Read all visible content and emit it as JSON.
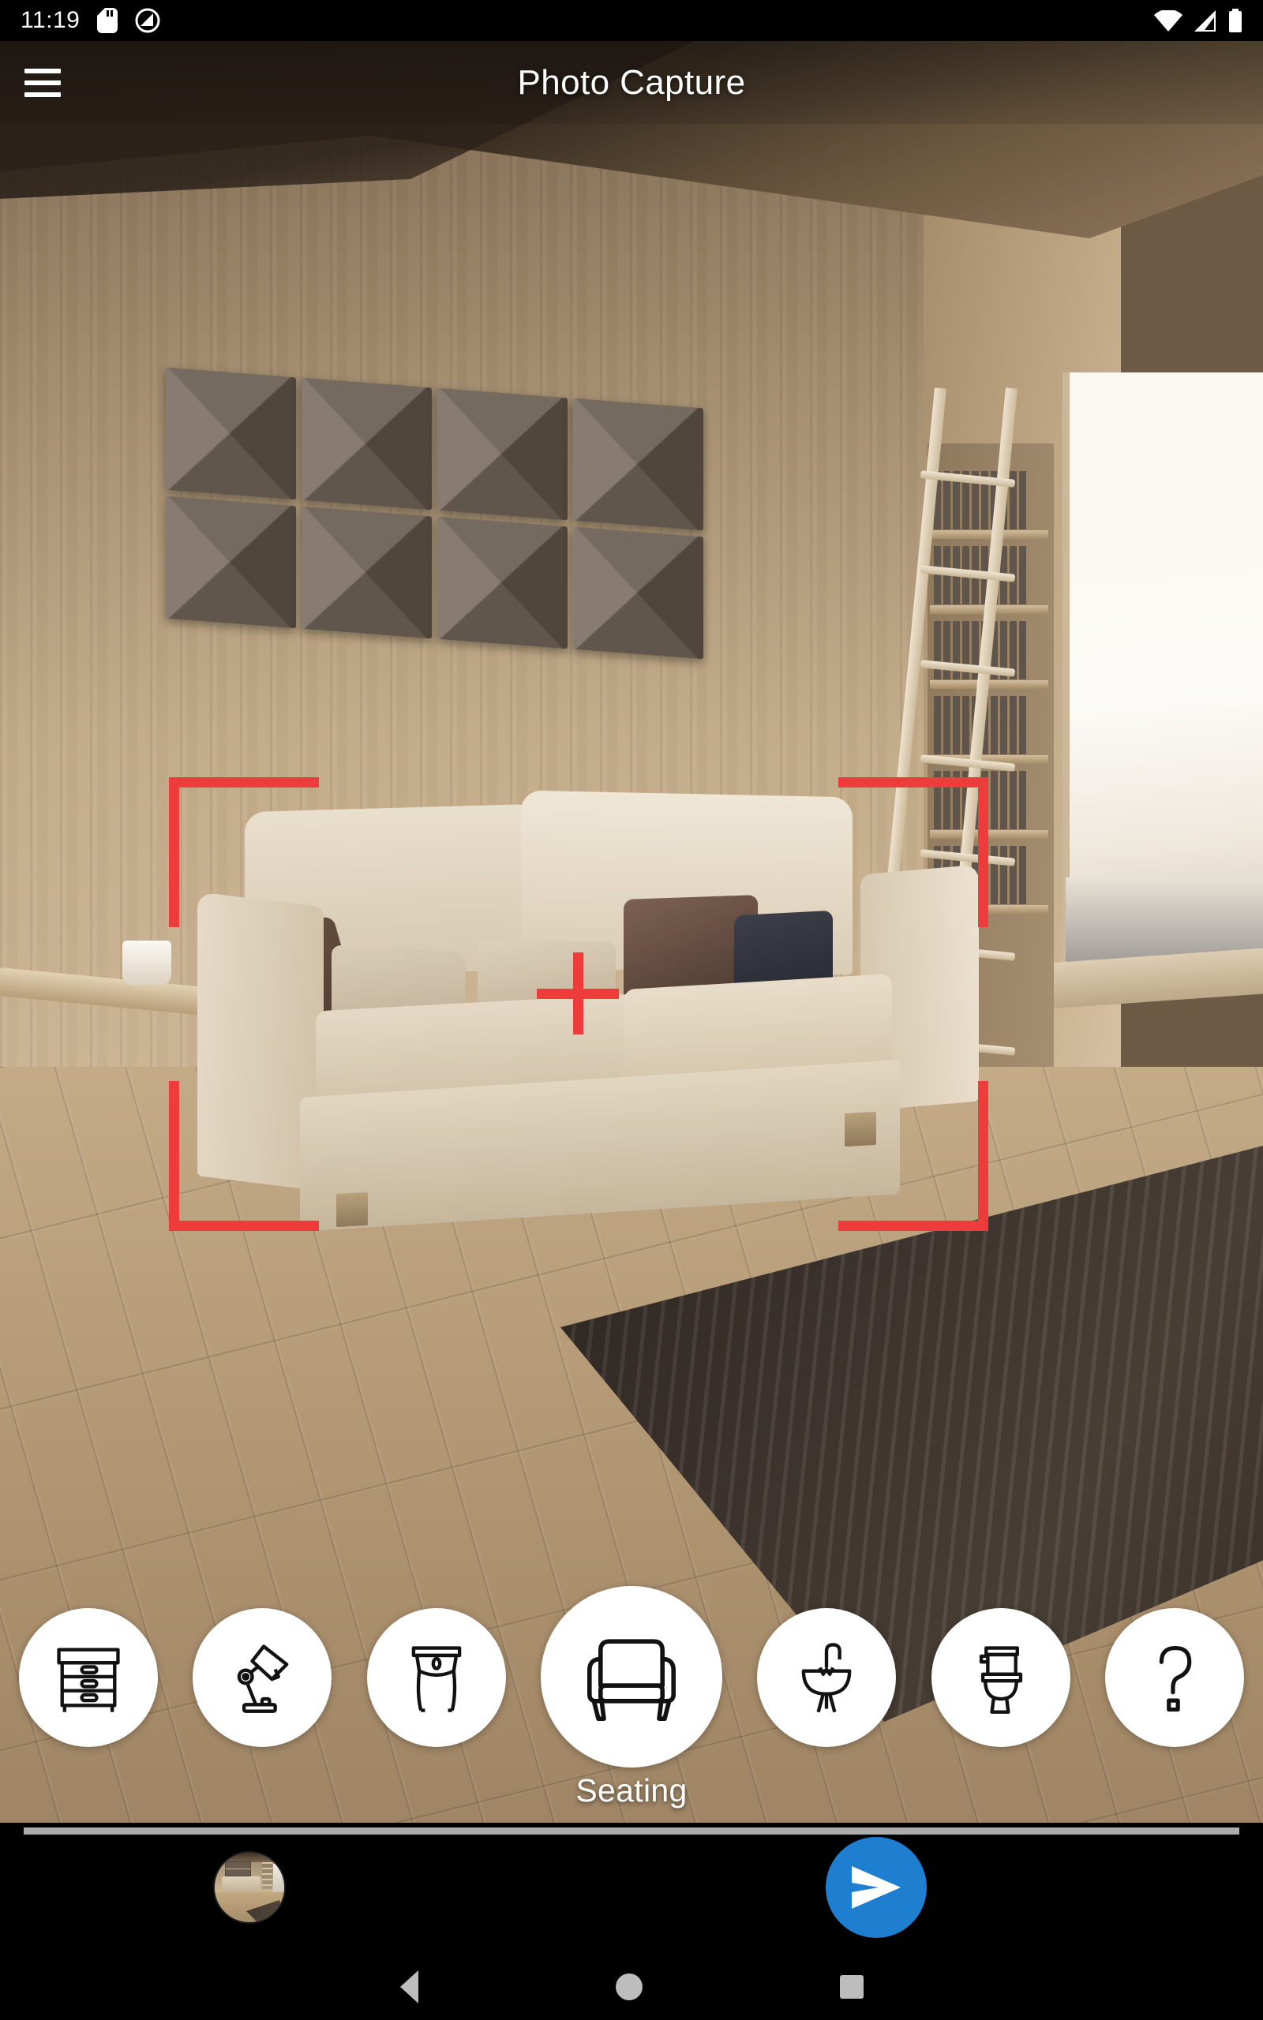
{
  "status_bar": {
    "time": "11:19",
    "icons": [
      "sd-card-icon",
      "do-not-disturb-icon",
      "wifi-icon",
      "cellular-signal-icon",
      "battery-icon"
    ]
  },
  "app_bar": {
    "title": "Photo Capture",
    "menu_icon": "hamburger-menu-icon"
  },
  "viewfinder": {
    "reticle_color": "#EE3B3B",
    "crosshair_icon": "crosshair-icon",
    "brackets": [
      "top-left",
      "top-right",
      "bottom-left",
      "bottom-right"
    ],
    "scene_description": "living room with beige sofa, cushions, wall panels, bookshelf ladder and dark rug"
  },
  "categories": {
    "selected_index": 3,
    "selected_label": "Seating",
    "items": [
      {
        "icon": "dresser-icon",
        "name": "storage"
      },
      {
        "icon": "desk-lamp-icon",
        "name": "lighting"
      },
      {
        "icon": "console-table-icon",
        "name": "tables"
      },
      {
        "icon": "sofa-icon",
        "name": "seating",
        "label": "Seating"
      },
      {
        "icon": "sink-icon",
        "name": "sink"
      },
      {
        "icon": "toilet-icon",
        "name": "toilet"
      },
      {
        "icon": "question-mark-icon",
        "name": "other"
      }
    ]
  },
  "action_bar": {
    "thumbnail_name": "last-capture-thumbnail",
    "send_icon": "send-icon",
    "send_color": "#1E7FD0"
  },
  "nav_bar": {
    "back_icon": "back-triangle-icon",
    "home_icon": "home-circle-icon",
    "recents_icon": "recents-square-icon"
  }
}
